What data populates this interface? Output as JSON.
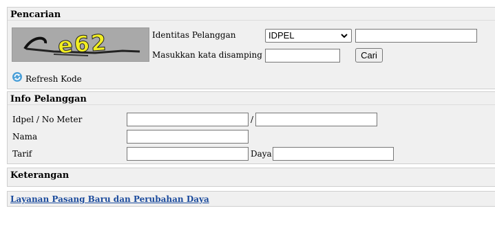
{
  "search": {
    "title": "Pencarian",
    "captcha_text": "e62",
    "customer_id_label": "Identitas Pelanggan",
    "id_type_selected": "IDPEL",
    "id_value": "",
    "captcha_label": "Masukkan kata disamping",
    "captcha_input": "",
    "search_button": "Cari",
    "refresh_label": "Refresh Kode"
  },
  "info": {
    "title": "Info Pelanggan",
    "idpel_label": "Idpel / No Meter",
    "separator": "/",
    "name_label": "Nama",
    "tariff_label": "Tarif",
    "power_label": "Daya",
    "idpel_value": "",
    "meter_value": "",
    "name_value": "",
    "tariff_value": "",
    "power_value": ""
  },
  "notes": {
    "title": "Keterangan"
  },
  "footer": {
    "link_label": "Layanan Pasang Baru dan Perubahan Daya"
  }
}
